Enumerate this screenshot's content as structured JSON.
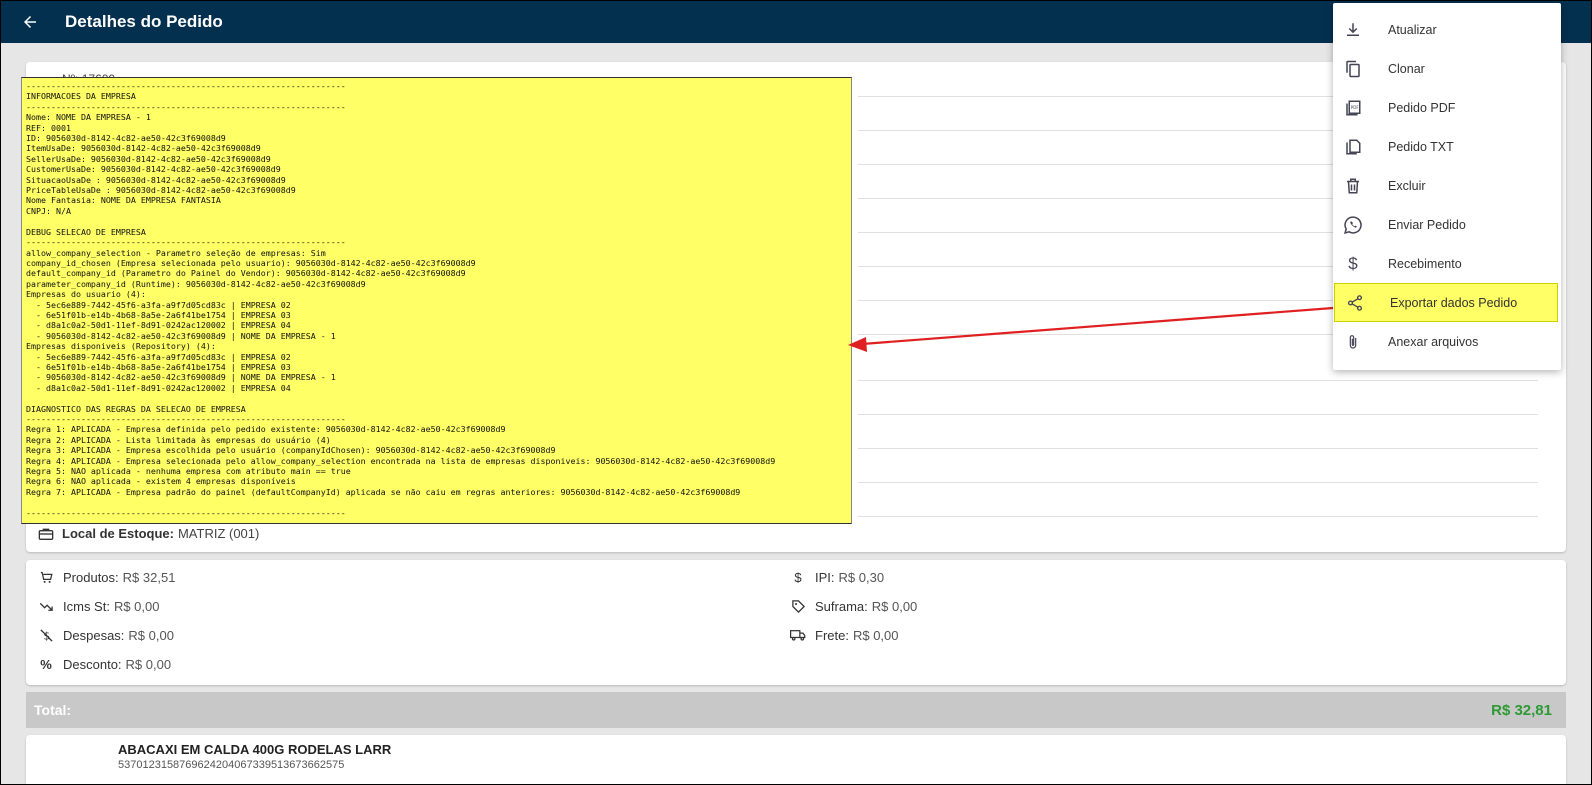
{
  "header": {
    "title": "Detalhes do Pedido"
  },
  "order": {
    "number_label": "Nº: 17600"
  },
  "stock": {
    "label": "Local de Estoque:",
    "value": "MATRIZ (001)"
  },
  "totals": {
    "produtos": {
      "label": "Produtos:",
      "value": "R$ 32,51"
    },
    "icms_st": {
      "label": "Icms St:",
      "value": "R$ 0,00"
    },
    "despesas": {
      "label": "Despesas:",
      "value": "R$ 0,00"
    },
    "desconto": {
      "label": "Desconto:",
      "value": "R$ 0,00"
    },
    "ipi": {
      "label": "IPI:",
      "value": "R$ 0,30"
    },
    "suframa": {
      "label": "Suframa:",
      "value": "R$ 0,00"
    },
    "frete": {
      "label": "Frete:",
      "value": "R$ 0,00"
    }
  },
  "total": {
    "label": "Total:",
    "value": "R$ 32,81"
  },
  "product": {
    "name": "ABACAXI EM CALDA 400G RODELAS LARR",
    "code": "5370123158769624204067339513673662575"
  },
  "menu": {
    "items": [
      {
        "label": "Atualizar",
        "icon": "download-icon"
      },
      {
        "label": "Clonar",
        "icon": "copy-icon"
      },
      {
        "label": "Pedido PDF",
        "icon": "pdf-icon"
      },
      {
        "label": "Pedido TXT",
        "icon": "file-icon"
      },
      {
        "label": "Excluir",
        "icon": "trash-icon"
      },
      {
        "label": "Enviar Pedido",
        "icon": "whatsapp-icon"
      },
      {
        "label": "Recebimento",
        "icon": "dollar-icon"
      },
      {
        "label": "Exportar dados Pedido",
        "icon": "share-icon"
      },
      {
        "label": "Anexar arquivos",
        "icon": "paperclip-icon"
      }
    ]
  },
  "debug": {
    "text": "----------------------------------------------------------------\nINFORMACOES DA EMPRESA\n----------------------------------------------------------------\nNome: NOME DA EMPRESA - 1\nREF: 0001\nID: 9056030d-8142-4c82-ae50-42c3f69008d9\nItemUsaDe: 9056030d-8142-4c82-ae50-42c3f69008d9\nSellerUsaDe: 9056030d-8142-4c82-ae50-42c3f69008d9\nCustomerUsaDe: 9056030d-8142-4c82-ae50-42c3f69008d9\nSituacaoUsaDe : 9056030d-8142-4c82-ae50-42c3f69008d9\nPriceTableUsaDe : 9056030d-8142-4c82-ae50-42c3f69008d9\nNome Fantasia: NOME DA EMPRESA FANTASIA\nCNPJ: N/A\n\nDEBUG SELECAO DE EMPRESA\n----------------------------------------------------------------\nallow_company_selection - Parametro seleção de empresas: Sim\ncompany_id_chosen (Empresa selecionada pelo usuario): 9056030d-8142-4c82-ae50-42c3f69008d9\ndefault_company_id (Parametro do Painel do Vendor): 9056030d-8142-4c82-ae50-42c3f69008d9\nparameter_company_id (Runtime): 9056030d-8142-4c82-ae50-42c3f69008d9\nEmpresas do usuario (4):\n  - 5ec6e889-7442-45f6-a3fa-a9f7d05cd83c | EMPRESA 02\n  - 6e51f01b-e14b-4b68-8a5e-2a6f41be1754 | EMPRESA 03\n  - d8a1c0a2-50d1-11ef-8d91-0242ac120002 | EMPRESA 04\n  - 9056030d-8142-4c82-ae50-42c3f69008d9 | NOME DA EMPRESA - 1\nEmpresas disponiveis (Repository) (4):\n  - 5ec6e889-7442-45f6-a3fa-a9f7d05cd83c | EMPRESA 02\n  - 6e51f01b-e14b-4b68-8a5e-2a6f41be1754 | EMPRESA 03\n  - 9056030d-8142-4c82-ae50-42c3f69008d9 | NOME DA EMPRESA - 1\n  - d8a1c0a2-50d1-11ef-8d91-0242ac120002 | EMPRESA 04\n\nDIAGNOSTICO DAS REGRAS DA SELECAO DE EMPRESA\n----------------------------------------------------------------\nRegra 1: APLICADA - Empresa definida pelo pedido existente: 9056030d-8142-4c82-ae50-42c3f69008d9\nRegra 2: APLICADA - Lista limitada às empresas do usuário (4)\nRegra 3: APLICADA - Empresa escolhida pelo usuário (companyIdChosen): 9056030d-8142-4c82-ae50-42c3f69008d9\nRegra 4: APLICADA - Empresa selecionada pelo allow_company_selection encontrada na lista de empresas disponiveis: 9056030d-8142-4c82-ae50-42c3f69008d9\nRegra 5: NAO aplicada - nenhuma empresa com atributo main == true\nRegra 6: NAO aplicada - existem 4 empresas disponíveis\nRegra 7: APLICADA - Empresa padrão do painel (defaultCompanyId) aplicada se não caiu em regras anteriores: 9056030d-8142-4c82-ae50-42c3f69008d9\n\n----------------------------------------------------------------"
  },
  "colors": {
    "appbar": "#04304f",
    "highlight": "#ffff66",
    "total_value": "#2e9a33",
    "arrow": "#e02020"
  }
}
